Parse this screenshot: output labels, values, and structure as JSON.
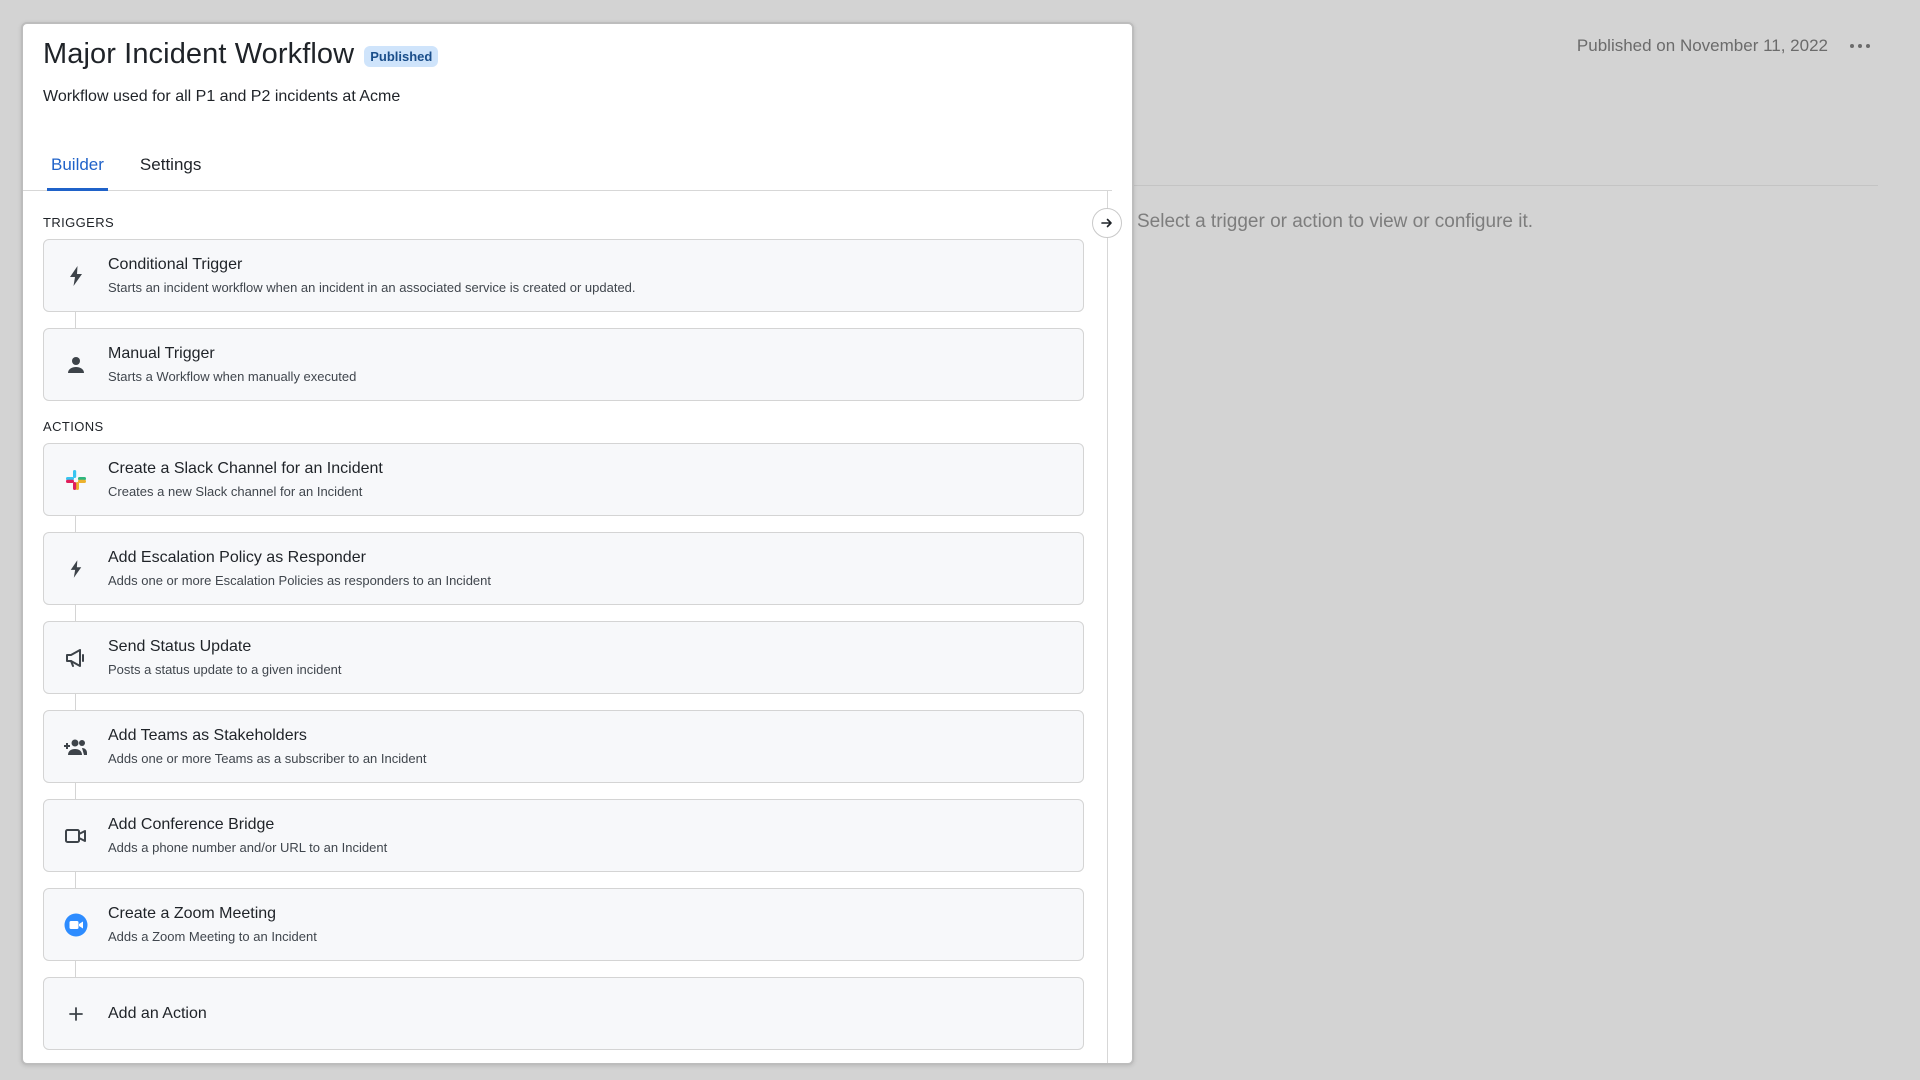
{
  "workflow": {
    "title": "Major Incident Workflow",
    "status_badge": "Published",
    "description": "Workflow used for all P1 and P2 incidents at Acme",
    "published_info": "Published on November 11, 2022"
  },
  "tabs": [
    {
      "label": "Builder",
      "active": true
    },
    {
      "label": "Settings",
      "active": false
    }
  ],
  "sections": {
    "triggers_label": "TRIGGERS",
    "actions_label": "ACTIONS"
  },
  "triggers": [
    {
      "icon": "lightning-icon",
      "name": "Conditional Trigger",
      "description": "Starts an incident workflow when an incident in an associated service is created or updated."
    },
    {
      "icon": "person-icon",
      "name": "Manual Trigger",
      "description": "Starts a Workflow when manually executed"
    }
  ],
  "actions": [
    {
      "icon": "slack-icon",
      "name": "Create a Slack Channel for an Incident",
      "description": "Creates a new Slack channel for an Incident"
    },
    {
      "icon": "lightning-icon",
      "name": "Add Escalation Policy as Responder",
      "description": "Adds one or more Escalation Policies as responders to an Incident"
    },
    {
      "icon": "megaphone-icon",
      "name": "Send Status Update",
      "description": "Posts a status update to a given incident"
    },
    {
      "icon": "team-add-icon",
      "name": "Add Teams as Stakeholders",
      "description": "Adds one or more Teams as a subscriber to an Incident"
    },
    {
      "icon": "video-camera-icon",
      "name": "Add Conference Bridge",
      "description": "Adds a phone number and/or URL to an Incident"
    },
    {
      "icon": "zoom-icon",
      "name": "Create a Zoom Meeting",
      "description": "Adds a Zoom Meeting to an Incident"
    }
  ],
  "add_action_label": "Add an Action",
  "detail_hint": "Select a trigger or action to view or configure it.",
  "colors": {
    "accent": "#1f62c9",
    "badge_bg": "#cfe4fb",
    "overlay": "#d3d3d3",
    "zoom": "#2d8cff"
  }
}
